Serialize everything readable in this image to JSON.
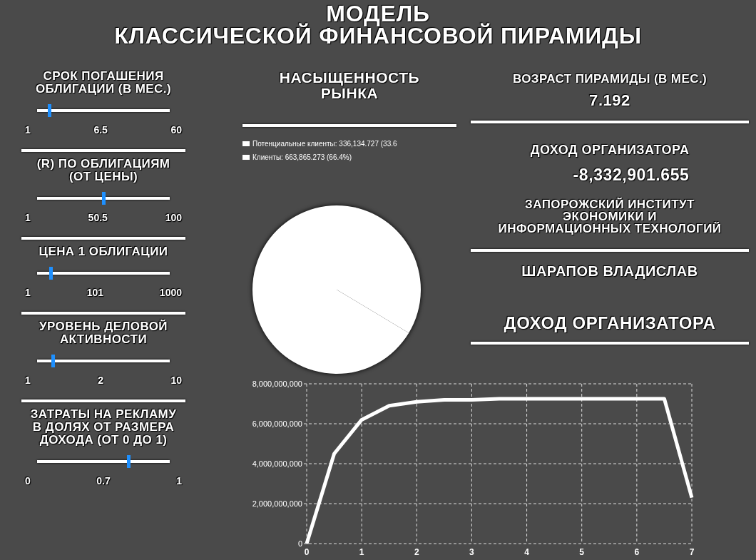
{
  "title": [
    "МОДЕЛЬ",
    "КЛАССИЧЕСКОЙ ФИНАНСОВОЙ ПИРАМИДЫ"
  ],
  "sliders": [
    {
      "label": "СРОК ПОГАШЕНИЯ ОБЛИГАЦИИ (В МЕС.)",
      "min": "1",
      "value": "6.5",
      "max": "60",
      "level": 0.09
    },
    {
      "label": "(R) ПО ОБЛИГАЦИЯМ (ОТ ЦЕНЫ)",
      "min": "1",
      "value": "50.5",
      "max": "100",
      "level": 0.5
    },
    {
      "label": "ЦЕНА 1 ОБЛИГАЦИИ",
      "min": "1",
      "value": "101",
      "max": "1000",
      "level": 0.1
    },
    {
      "label": "УРОВЕНЬ ДЕЛОВОЙ АКТИВНОСТИ",
      "min": "1",
      "value": "2",
      "max": "10",
      "level": 0.12
    },
    {
      "label": "ЗАТРАТЫ НА РЕКЛАМУ В ДОЛЯХ ОТ РАЗМЕРА ДОХОДА (ОТ 0 ДО 1)",
      "min": "0",
      "value": "0.7",
      "max": "1",
      "level": 0.69
    }
  ],
  "saturation": {
    "title": "НАСЫЩЕННОСТЬ РЫНКА",
    "legend": [
      {
        "label": "Потенциальные клиенты: 336,134.727 (33.6",
        "color": "#ffffff"
      },
      {
        "label": "Клиенты: 663,865.273 (66.4%)",
        "color": "#ffffff"
      }
    ],
    "chart_data": {
      "type": "pie",
      "values": [
        33.6,
        66.4
      ]
    }
  },
  "age": {
    "label": "ВОЗРАСТ ПИРАМИДЫ (В МЕС.)",
    "value": "7.192"
  },
  "income": {
    "label": "ДОХОД ОРГАНИЗАТОРА",
    "value": "-8,332,901.655"
  },
  "institute": "ЗАПОРОЖСКИЙ ИНСТИТУТ\nЭКОНОМИКИ И\nИНФОРМАЦИОННЫХ ТЕХНОЛОГИЙ",
  "author": "ШАРАПОВ ВЛАДИСЛАВ",
  "income_chart": {
    "title": "ДОХОД ОРГАНИЗАТОРА",
    "chart_data": {
      "type": "line",
      "x": [
        0,
        0.5,
        1,
        1.5,
        2,
        2.5,
        3,
        3.5,
        4,
        4.5,
        5,
        5.5,
        6,
        6.5,
        7
      ],
      "grid": true,
      "series": [
        {
          "color": "#ffffff",
          "values": [
            0,
            4500000000,
            6200000000,
            6900000000,
            7100000000,
            7200000000,
            7200000000,
            7250000000,
            7250000000,
            7250000000,
            7250000000,
            7250000000,
            7250000000,
            7250000000,
            2300000000
          ]
        }
      ],
      "xlim": [
        0,
        7
      ],
      "ylim": [
        0,
        8000000000
      ],
      "xticks": [
        0,
        1,
        2,
        3,
        4,
        5,
        6,
        7
      ],
      "yticks": [
        {
          "value": 0,
          "label": "0"
        },
        {
          "value": 2000000000,
          "label": "2,000,000,000"
        },
        {
          "value": 4000000000,
          "label": "4,000,000,000"
        },
        {
          "value": 6000000000,
          "label": "6,000,000,000"
        },
        {
          "value": 8000000000,
          "label": "8,000,000,000"
        }
      ]
    }
  }
}
